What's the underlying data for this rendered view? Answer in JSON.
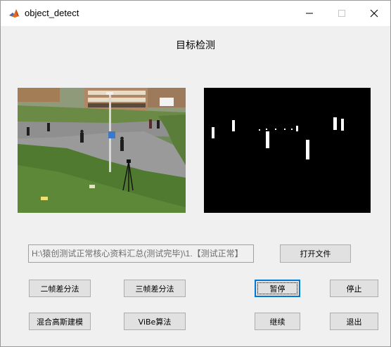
{
  "window": {
    "title": "object_detect",
    "controls": {
      "minimize_icon": "minimize-icon",
      "maximize_icon": "maximize-icon",
      "close_icon": "close-icon"
    }
  },
  "heading": "目标检测",
  "file": {
    "path": "H:\\猿创测试正常核心资料汇总(测试完毕)\\1.【测试正常】"
  },
  "buttons": {
    "open_file": "打开文件",
    "two_frame_diff": "二帧差分法",
    "three_frame_diff": "三帧差分法",
    "pause": "暂停",
    "stop": "停止",
    "gmm": "混合高斯建模",
    "vibe": "ViBe算法",
    "resume": "继续",
    "exit": "退出"
  },
  "colors": {
    "window_bg": "#f0f0f0",
    "button_bg": "#e1e1e1",
    "focus_border": "#0078d7",
    "mask_bg": "#000000",
    "mask_fg": "#ffffff"
  }
}
